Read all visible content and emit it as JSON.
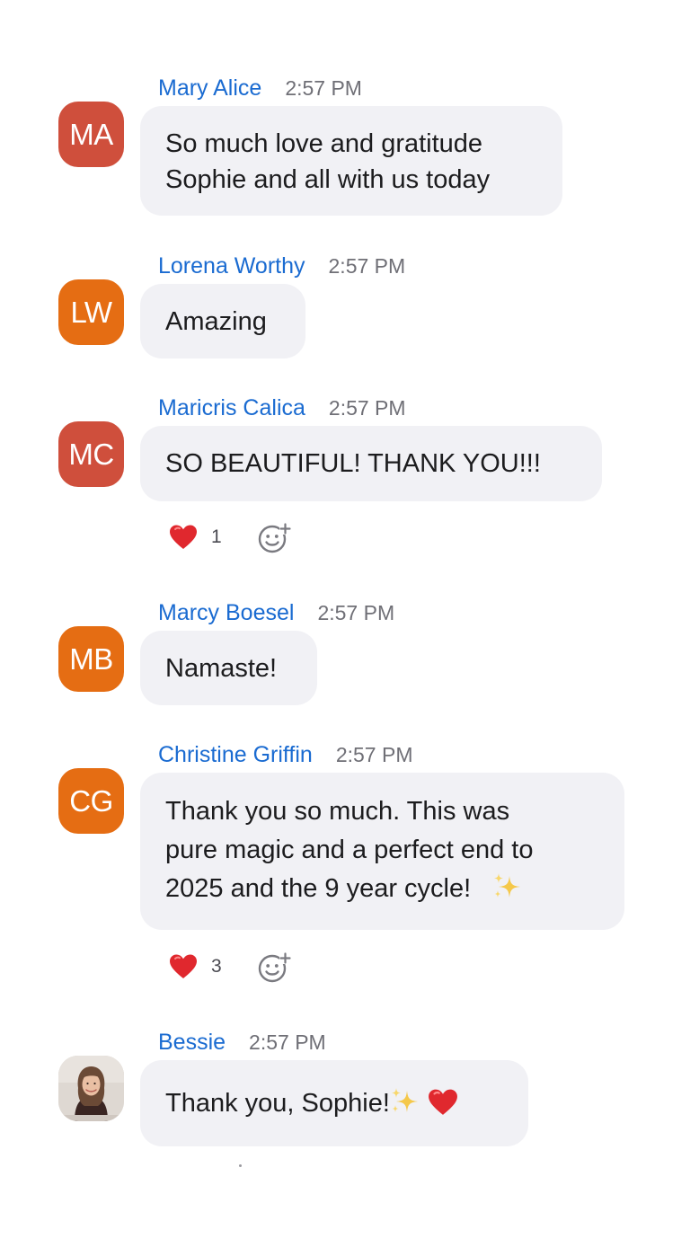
{
  "messages": [
    {
      "sender": "Mary Alice",
      "time": "2:57 PM",
      "avatar_initials": "MA",
      "lines": [
        "So much love and gratitude",
        "Sophie and all with us today"
      ]
    },
    {
      "sender": "Lorena Worthy",
      "time": "2:57 PM",
      "avatar_initials": "LW",
      "lines": [
        "Amazing"
      ]
    },
    {
      "sender": "Maricris Calica",
      "time": "2:57 PM",
      "avatar_initials": "MC",
      "lines": [
        "SO BEAUTIFUL! THANK YOU!!!"
      ],
      "reaction": {
        "emoji": "heart-icon",
        "count": "1"
      }
    },
    {
      "sender": "Marcy Boesel",
      "time": "2:57 PM",
      "avatar_initials": "MB",
      "lines": [
        "Namaste!"
      ]
    },
    {
      "sender": "Christine Griffin",
      "time": "2:57 PM",
      "avatar_initials": "CG",
      "lines": [
        "Thank you so much.  This was",
        "pure magic and a perfect end to",
        "2025 and the 9 year cycle!"
      ],
      "trailing_emoji": "sparkles-icon",
      "reaction": {
        "emoji": "heart-icon",
        "count": "3"
      }
    },
    {
      "sender": "Bessie",
      "time": "2:57 PM",
      "avatar": "profile-photo",
      "text": "Thank you, Sophie!",
      "trailing_emoji": [
        "sparkles-icon",
        "heart-icon"
      ]
    }
  ],
  "colors": {
    "sender_name": "#1a6bd1",
    "timestamp": "#6f6f76",
    "bubble_bg": "#f1f1f5",
    "avatar_red": "#cf4f3c",
    "avatar_orange": "#e56d13",
    "reaction_heart": "#e0282e"
  }
}
